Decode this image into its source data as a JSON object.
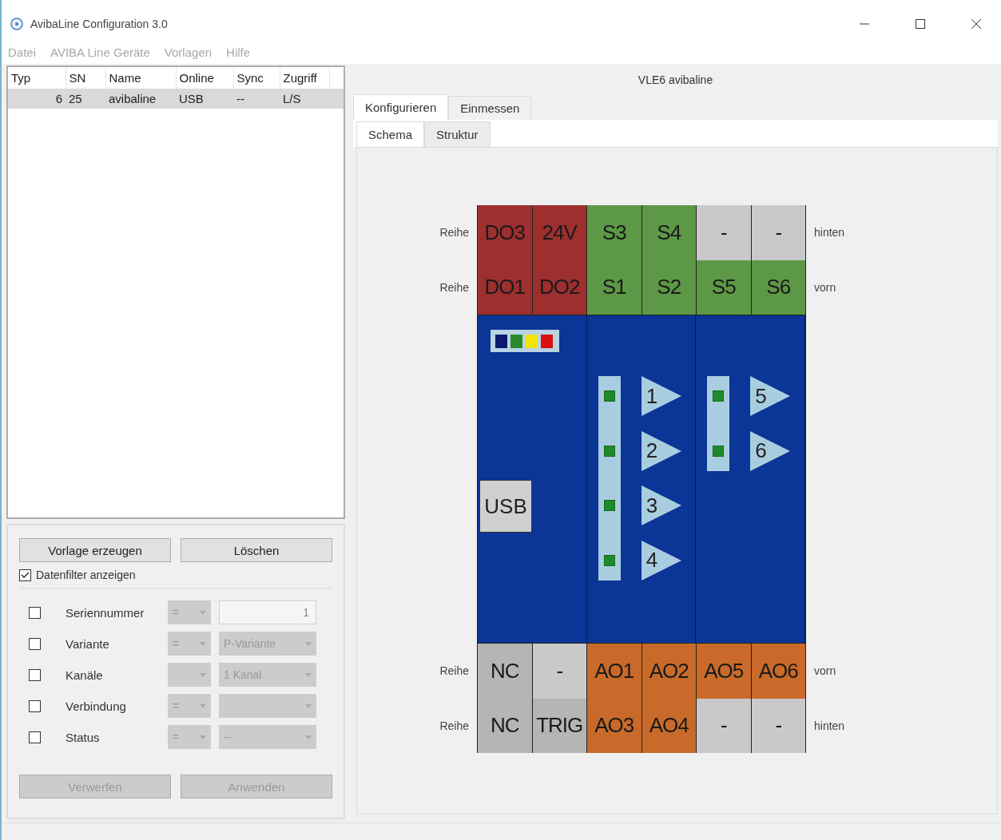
{
  "window": {
    "title": "AvibaLine Configuration 3.0"
  },
  "menu": [
    {
      "label": "Datei",
      "disabled": true
    },
    {
      "label": "AVIBA Line Geräte",
      "disabled": true
    },
    {
      "label": "Vorlagen",
      "disabled": true
    },
    {
      "label": "Hilfe",
      "disabled": true
    }
  ],
  "device_table": {
    "columns": [
      "Typ",
      "SN",
      "Name",
      "Online",
      "Sync",
      "Zugriff"
    ],
    "rows": [
      {
        "cells": [
          "6",
          "25",
          "avibaline",
          "USB",
          "--",
          "L/S"
        ],
        "selected": true
      }
    ]
  },
  "template_buttons": [
    {
      "label": "Vorlage erzeugen",
      "disabled": false
    },
    {
      "label": "Löschen",
      "disabled": false
    }
  ],
  "show_filter": {
    "label": "Datenfilter anzeigen",
    "checked": true
  },
  "filters": [
    {
      "label": "Seriennummer",
      "checked": false,
      "operator": "=",
      "kind": "input",
      "value": "1"
    },
    {
      "label": "Variante",
      "checked": false,
      "operator": "=",
      "kind": "select",
      "value": "P-Variante"
    },
    {
      "label": "Kanäle",
      "checked": false,
      "kind": "select",
      "value": "1 Kanal"
    },
    {
      "label": "Verbindung",
      "checked": false,
      "operator": "=",
      "kind": "select"
    },
    {
      "label": "Status",
      "checked": false,
      "operator": "=",
      "kind": "select",
      "value": "--"
    }
  ],
  "filter_buttons": [
    {
      "label": "Verwerfen",
      "disabled": true
    },
    {
      "label": "Anwenden",
      "disabled": true
    }
  ],
  "device_title": "VLE6 avibaline",
  "tabs": [
    {
      "label": "Konfigurieren",
      "selected": true
    },
    {
      "label": "Einmessen",
      "selected": false
    }
  ],
  "subtabs": [
    {
      "label": "Schema",
      "selected": true
    },
    {
      "label": "Struktur",
      "selected": false
    }
  ],
  "schema": {
    "top_rows": [
      {
        "label": "Reihe",
        "side": "hinten",
        "terminals": [
          {
            "text": "DO3",
            "color": "#9e2f2f"
          },
          {
            "text": "24V",
            "color": "#9e2f2f"
          },
          {
            "text": "S3",
            "color": "#5d9846"
          },
          {
            "text": "S4",
            "color": "#5d9846"
          },
          {
            "text": "-",
            "color": "#c9c9c9"
          },
          {
            "text": "-",
            "color": "#c9c9c9"
          }
        ]
      },
      {
        "label": "Reihe",
        "side": "vorn",
        "terminals": [
          {
            "text": "DO1",
            "color": "#9e2f2f"
          },
          {
            "text": "DO2",
            "color": "#9e2f2f"
          },
          {
            "text": "S1",
            "color": "#5d9846"
          },
          {
            "text": "S2",
            "color": "#5d9846"
          },
          {
            "text": "S5",
            "color": "#5d9846"
          },
          {
            "text": "S6",
            "color": "#5d9846"
          }
        ]
      }
    ],
    "usb": "USB",
    "channel_groups": [
      [
        "1",
        "2",
        "3",
        "4"
      ],
      [
        "5",
        "6"
      ]
    ],
    "bottom_rows": [
      {
        "label": "Reihe",
        "side": "vorn",
        "terminals": [
          {
            "text": "NC",
            "color": "#b5b5b5"
          },
          {
            "text": "-",
            "color": "#c9c9c9"
          },
          {
            "text": "AO1",
            "color": "#c96a2a"
          },
          {
            "text": "AO2",
            "color": "#c96a2a"
          },
          {
            "text": "AO5",
            "color": "#c96a2a"
          },
          {
            "text": "AO6",
            "color": "#c96a2a"
          }
        ]
      },
      {
        "label": "Reihe",
        "side": "hinten",
        "terminals": [
          {
            "text": "NC",
            "color": "#b5b5b5"
          },
          {
            "text": "TRIG",
            "color": "#b5b5b5"
          },
          {
            "text": "AO3",
            "color": "#c96a2a"
          },
          {
            "text": "AO4",
            "color": "#c96a2a"
          },
          {
            "text": "-",
            "color": "#c9c9c9"
          },
          {
            "text": "-",
            "color": "#c9c9c9"
          }
        ]
      }
    ]
  }
}
